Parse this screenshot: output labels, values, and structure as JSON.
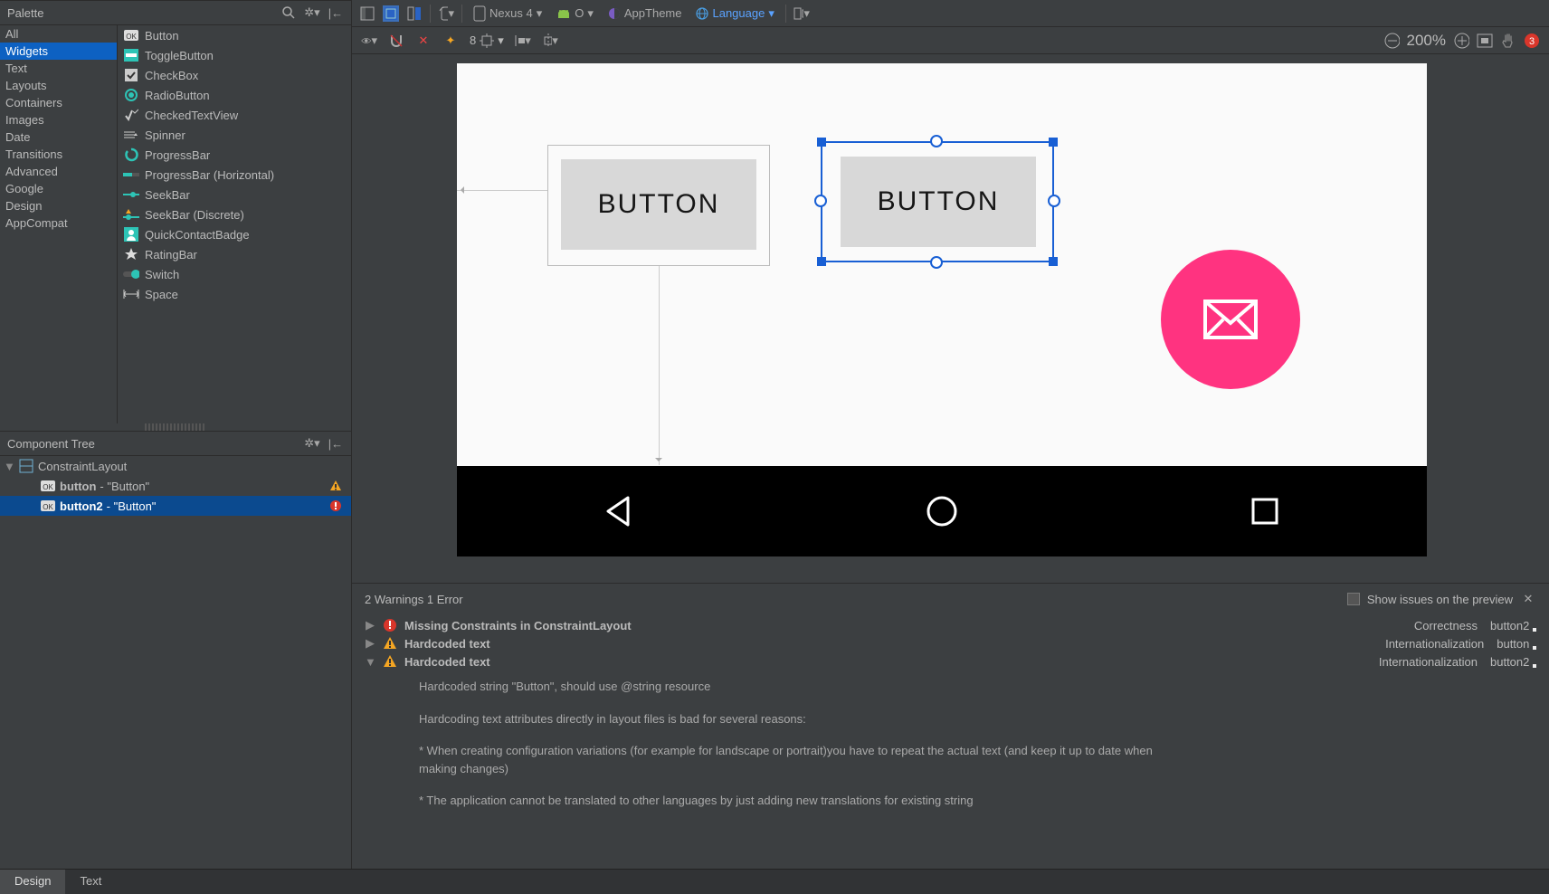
{
  "palette": {
    "title": "Palette",
    "categories": [
      "All",
      "Widgets",
      "Text",
      "Layouts",
      "Containers",
      "Images",
      "Date",
      "Transitions",
      "Advanced",
      "Google",
      "Design",
      "AppCompat"
    ],
    "selectedCategory": "Widgets",
    "widgets": [
      "Button",
      "ToggleButton",
      "CheckBox",
      "RadioButton",
      "CheckedTextView",
      "Spinner",
      "ProgressBar",
      "ProgressBar (Horizontal)",
      "SeekBar",
      "SeekBar (Discrete)",
      "QuickContactBadge",
      "RatingBar",
      "Switch",
      "Space"
    ]
  },
  "componentTree": {
    "title": "Component Tree",
    "root": "ConstraintLayout",
    "children": [
      {
        "id": "button",
        "label": "\"Button\"",
        "badge": "warn"
      },
      {
        "id": "button2",
        "label": "\"Button\"",
        "badge": "error",
        "selected": true
      }
    ]
  },
  "topToolbar": {
    "device": "Nexus 4",
    "api": "O",
    "theme": "AppTheme",
    "locale": "Language"
  },
  "designToolbar": {
    "marginDefault": "8"
  },
  "zoom": {
    "value": "200%"
  },
  "canvas": {
    "button1": "BUTTON",
    "button2": "BUTTON"
  },
  "issues": {
    "summary": "2 Warnings 1 Error",
    "showPreviewLabel": "Show issues on the preview",
    "rows": [
      {
        "icon": "error",
        "title": "Missing Constraints in ConstraintLayout",
        "cat": "Correctness",
        "target": "button2 <Button>",
        "open": false
      },
      {
        "icon": "warn",
        "title": "Hardcoded text",
        "cat": "Internationalization",
        "target": "button <Button>",
        "open": false
      },
      {
        "icon": "warn",
        "title": "Hardcoded text",
        "cat": "Internationalization",
        "target": "button2 <Button>",
        "open": true
      }
    ],
    "detail": {
      "l1": "Hardcoded string \"Button\", should use @string resource",
      "l2": "Hardcoding text attributes directly in layout files is bad for several reasons:",
      "l3": "* When creating configuration variations (for example for landscape or portrait)you have to repeat the actual text (and keep it up to date when making changes)",
      "l4": "* The application cannot be translated to other languages by just adding new translations for existing string"
    }
  },
  "bottomTabs": {
    "design": "Design",
    "text": "Text"
  }
}
